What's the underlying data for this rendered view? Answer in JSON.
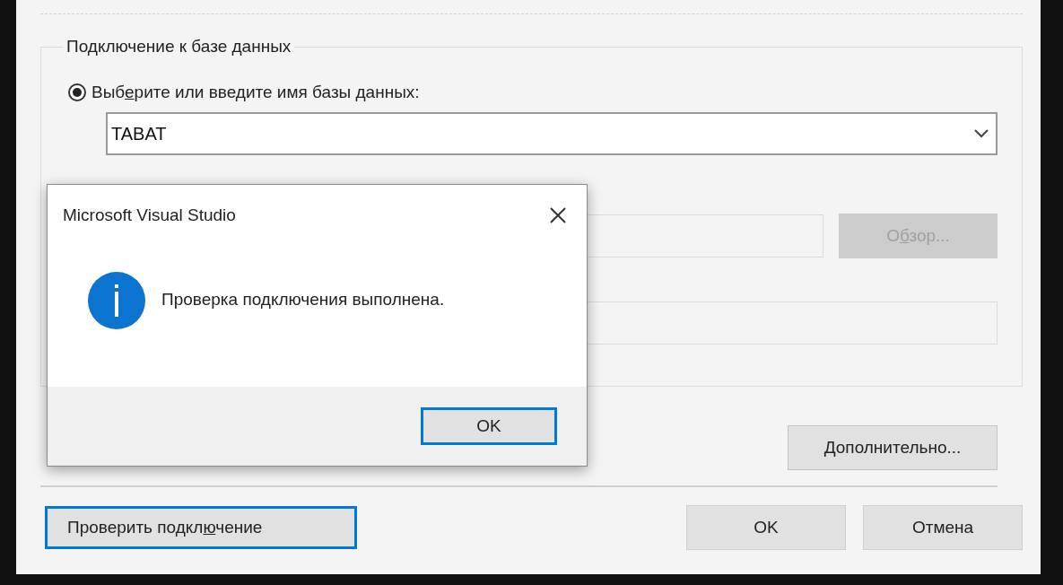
{
  "dialog": {
    "group_title": "Подключение к базе данных",
    "database_option": {
      "selected": true,
      "label": {
        "pre": "Выб",
        "access_key": "е",
        "post": "рите или введите имя базы данных:"
      }
    },
    "database_name": {
      "value": "TABAT"
    },
    "file_field": {
      "disabled": true
    },
    "browse_button": {
      "disabled": true,
      "label": {
        "pre": "О",
        "access_key": "б",
        "post": "зор..."
      }
    },
    "advanced_button": {
      "label": {
        "access_key": "Д",
        "post": "ополнительно..."
      }
    },
    "test_button": {
      "focused": true,
      "label": {
        "pre": "Проверить подкл",
        "access_key": "ю",
        "post": "чение"
      }
    },
    "ok_button": {
      "label": "OK"
    },
    "cancel_button": {
      "label": "Отмена"
    }
  },
  "message_box": {
    "title": "Microsoft Visual Studio",
    "message": "Проверка подключения выполнена.",
    "ok_button": {
      "label": "OK",
      "focused": true
    }
  }
}
